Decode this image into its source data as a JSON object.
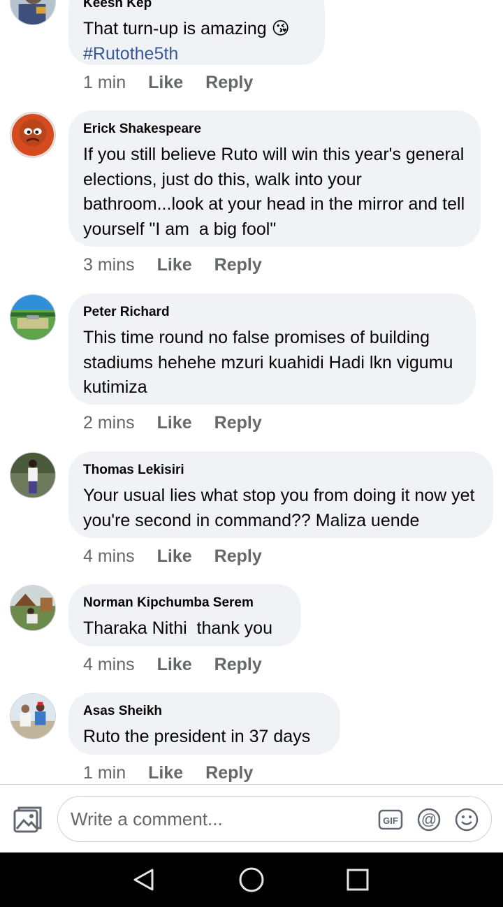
{
  "comments": [
    {
      "author": "Keesh Kep",
      "text": "That turn-up is amazing 😘",
      "hashtag": "#Rutothe5th",
      "time": "1 min",
      "like_label": "Like",
      "reply_label": "Reply",
      "avatar_icon": "profile-photo-icon"
    },
    {
      "author": "Erick Shakespeare",
      "text": "If you still believe Ruto will win this year's general elections, just do this, walk into your bathroom...look at your head in the mirror and tell yourself \"I am  a big fool\"",
      "time": "3 mins",
      "like_label": "Like",
      "reply_label": "Reply",
      "avatar_icon": "cartoon-face-avatar-icon"
    },
    {
      "author": "Peter Richard",
      "text": "This time round no false promises of building stadiums hehehe mzuri kuahidi Hadi lkn vigumu kutimiza",
      "time": "2 mins",
      "like_label": "Like",
      "reply_label": "Reply",
      "avatar_icon": "landscape-avatar-icon"
    },
    {
      "author": "Thomas Lekisiri",
      "text": "Your usual lies what stop you from doing it now yet you're second in command?? Maliza uende",
      "time": "4 mins",
      "like_label": "Like",
      "reply_label": "Reply",
      "avatar_icon": "person-standing-avatar-icon"
    },
    {
      "author": "Norman Kipchumba Serem",
      "text": "Tharaka Nithi  thank you",
      "time": "4 mins",
      "like_label": "Like",
      "reply_label": "Reply",
      "avatar_icon": "outdoor-person-avatar-icon"
    },
    {
      "author": "Asas Sheikh",
      "text": "Ruto the president in 37 days",
      "time": "1 min",
      "like_label": "Like",
      "reply_label": "Reply",
      "avatar_icon": "group-avatar-icon"
    }
  ],
  "composer": {
    "placeholder": "Write a comment...",
    "photo_icon": "photo-gallery-icon",
    "gif_label": "GIF",
    "mention_icon": "at-mention-icon",
    "emoji_icon": "smiley-icon"
  },
  "navbar": {
    "back_icon": "back-triangle-icon",
    "home_icon": "home-circle-icon",
    "recents_icon": "recents-square-icon"
  },
  "colors": {
    "bubble_bg": "#f0f2f5",
    "meta_text": "#65676b",
    "hashtag": "#385898",
    "navbar_bg": "#000000"
  }
}
